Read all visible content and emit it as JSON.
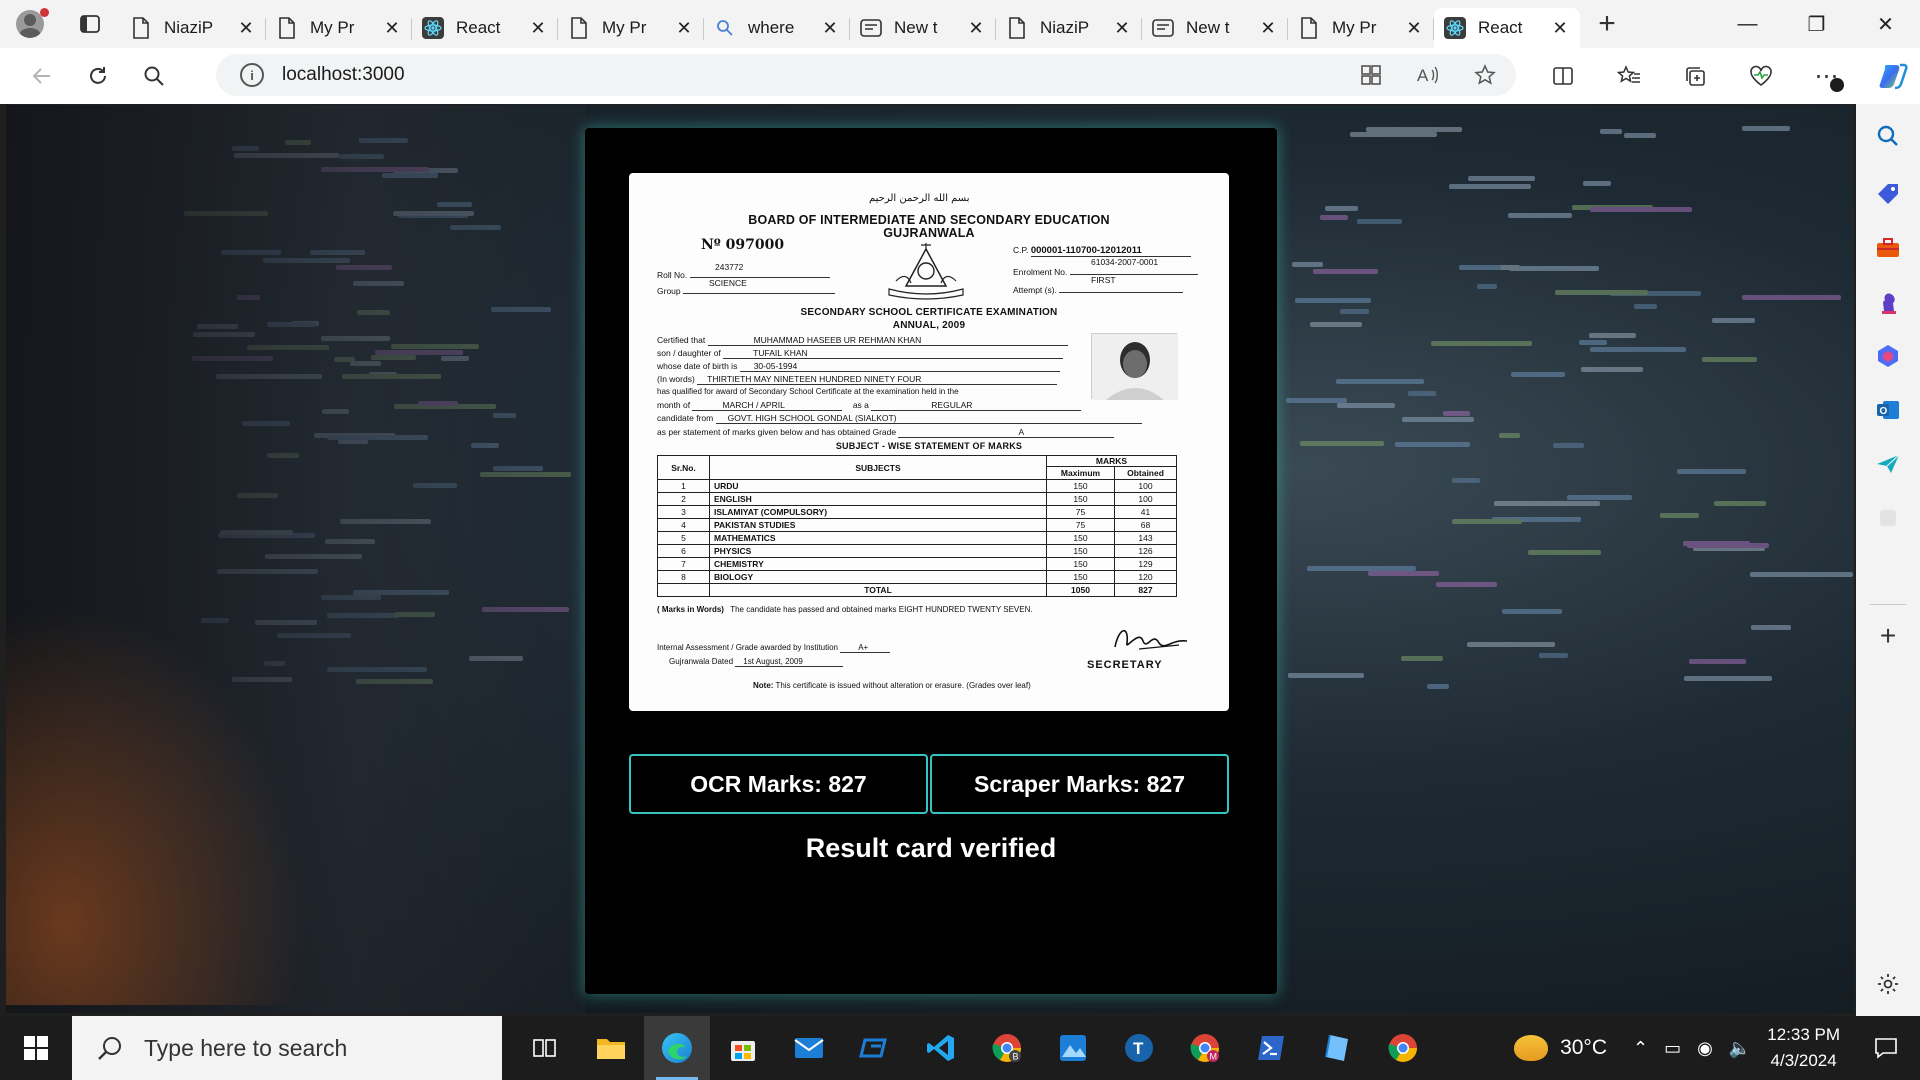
{
  "browser": {
    "tabs": [
      {
        "label": "NiaziP",
        "icon": "page-icon"
      },
      {
        "label": "My Pr",
        "icon": "page-icon"
      },
      {
        "label": "React",
        "icon": "react-icon"
      },
      {
        "label": "My Pr",
        "icon": "page-icon"
      },
      {
        "label": "where",
        "icon": "search-icon"
      },
      {
        "label": "New t",
        "icon": "newtab-icon"
      },
      {
        "label": "NiaziP",
        "icon": "page-icon"
      },
      {
        "label": "New t",
        "icon": "newtab-icon"
      },
      {
        "label": "My Pr",
        "icon": "page-icon"
      },
      {
        "label": "React",
        "icon": "react-icon",
        "active": true
      }
    ],
    "address": "localhost:3000"
  },
  "certificate": {
    "bismillah": "بسم الله الرحمن الرحيم",
    "board_title": "BOARD OF INTERMEDIATE AND SECONDARY EDUCATION",
    "board_city": "GUJRANWALA",
    "serial": "Nº 097000",
    "cp_label": "C.P.",
    "cp_value": "000001-110700-12012011",
    "enrolment_label": "Enrolment No.",
    "enrolment_value": "61034-2007-0001",
    "attempt_label": "Attempt (s).",
    "attempt_value": "FIRST",
    "roll_label": "Roll No.",
    "roll_value": "243772",
    "group_label": "Group",
    "group_value": "SCIENCE",
    "exam_title": "SECONDARY SCHOOL CERTIFICATE EXAMINATION",
    "exam_session": "ANNUAL, 2009",
    "certified_label": "Certified that",
    "certified_value": "MUHAMMAD HASEEB UR REHMAN KHAN",
    "parent_label": "son / daughter of",
    "parent_value": "TUFAIL KHAN",
    "dob_label": "whose date of birth is",
    "dob_value": "30-05-1994",
    "words_label": "(In words)",
    "words_value": "THIRTIETH  MAY NINETEEN HUNDRED NINETY FOUR",
    "qualified_text": "has qualified for award of Secondary School Certificate at the examination held in the",
    "month_label": "month of",
    "month_value": "MARCH / APRIL",
    "as_a_label": "as a",
    "as_a_value": "REGULAR",
    "candidate_label": "candidate from",
    "candidate_value": "GOVT. HIGH SCHOOL GONDAL (SIALKOT)",
    "statement_text": "as per statement of marks given below and has obtained  Grade",
    "grade_value": "A",
    "table_title": "SUBJECT - WISE  STATEMENT OF MARKS",
    "table_headers": {
      "srno": "Sr.No.",
      "subjects": "SUBJECTS",
      "marks": "MARKS",
      "max": "Maximum",
      "obtained": "Obtained"
    },
    "subjects": [
      {
        "sr": "1",
        "name": "URDU",
        "max": "150",
        "obtained": "100"
      },
      {
        "sr": "2",
        "name": "ENGLISH",
        "max": "150",
        "obtained": "100"
      },
      {
        "sr": "3",
        "name": "ISLAMIYAT (COMPULSORY)",
        "max": "75",
        "obtained": "41"
      },
      {
        "sr": "4",
        "name": "PAKISTAN STUDIES",
        "max": "75",
        "obtained": "68"
      },
      {
        "sr": "5",
        "name": "MATHEMATICS",
        "max": "150",
        "obtained": "143"
      },
      {
        "sr": "6",
        "name": "PHYSICS",
        "max": "150",
        "obtained": "126"
      },
      {
        "sr": "7",
        "name": "CHEMISTRY",
        "max": "150",
        "obtained": "129"
      },
      {
        "sr": "8",
        "name": "BIOLOGY",
        "max": "150",
        "obtained": "120"
      }
    ],
    "total_label": "TOTAL",
    "total_max": "1050",
    "total_obtained": "827",
    "marks_in_words_label": "( Marks in Words)",
    "marks_in_words": "The candidate has passed and obtained marks EIGHT HUNDRED TWENTY SEVEN.",
    "assessment_label": "Internal Assessment / Grade awarded by Institution",
    "assessment_value": "A+",
    "dated_label": "Gujranwala Dated",
    "dated_value": "1st August, 2009",
    "secretary": "SECRETARY",
    "note_label": "Note:",
    "note_text": "This certificate is issued without alteration or erasure. (Grades over leaf)"
  },
  "results": {
    "ocr_marks": "OCR Marks: 827",
    "scraper_marks": "Scraper Marks: 827",
    "status": "Result card verified"
  },
  "taskbar": {
    "search_placeholder": "Type here to search",
    "temperature": "30°C",
    "time": "12:33 PM",
    "date": "4/3/2024"
  },
  "colors": {
    "accent": "#35c6c2",
    "panel": "#000000"
  }
}
